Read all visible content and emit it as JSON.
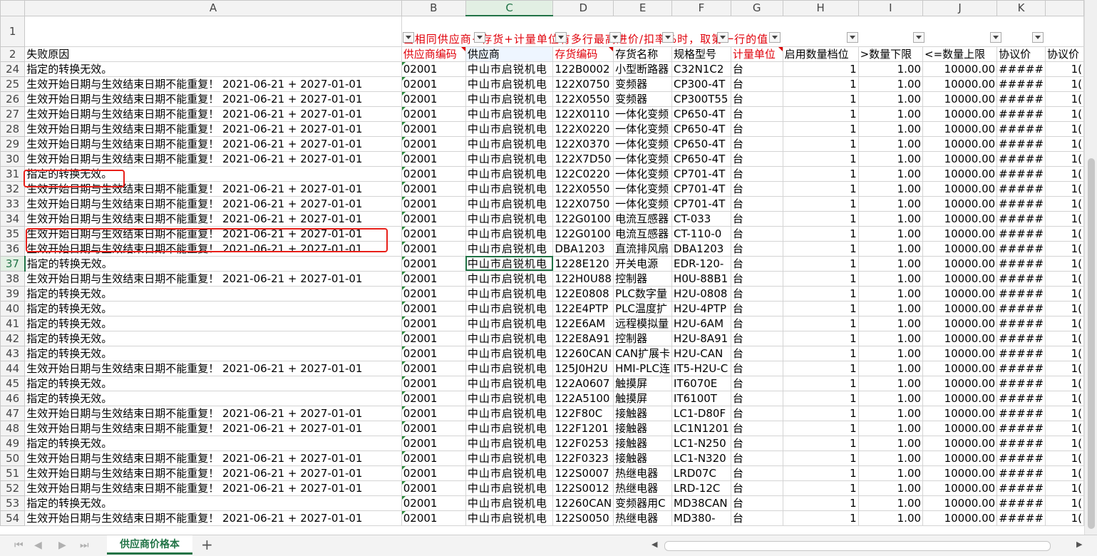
{
  "columns": [
    "",
    "A",
    "B",
    "C",
    "D",
    "E",
    "F",
    "G",
    "H",
    "I",
    "J",
    "K",
    ""
  ],
  "row1": {
    "row_num": "1",
    "b_note": "当相同供应商+存货+计量单位有多行最高进价/扣率%时，取第一行的值"
  },
  "row2": {
    "row_num": "2",
    "cells": [
      "失败原因",
      "供应商编码",
      "供应商",
      "存货编码",
      "存货名称",
      "规格型号",
      "计量单位",
      "启用数量档位",
      ">数量下限",
      "<=数量上限",
      "协议价",
      "协议价"
    ]
  },
  "rows": [
    {
      "n": "24",
      "a": "指定的转换无效。",
      "b": "02001",
      "c": "中山市启锐机电",
      "d": "122B0002",
      "e": "小型断路器",
      "f": "C32N1C2",
      "g": "台",
      "h": "1",
      "i": "1.00",
      "j": "10000.00",
      "k": "#####",
      "l": "1("
    },
    {
      "n": "25",
      "a": "生效开始日期与生效结束日期不能重复！ 2021-06-21 + 2027-01-01",
      "b": "02001",
      "c": "中山市启锐机电",
      "d": "122X0750",
      "e": "变频器",
      "f": "CP300-4T",
      "g": "台",
      "h": "1",
      "i": "1.00",
      "j": "10000.00",
      "k": "#####",
      "l": "1("
    },
    {
      "n": "26",
      "a": "生效开始日期与生效结束日期不能重复！ 2021-06-21 + 2027-01-01",
      "b": "02001",
      "c": "中山市启锐机电",
      "d": "122X0550",
      "e": "变频器",
      "f": "CP300T55",
      "g": "台",
      "h": "1",
      "i": "1.00",
      "j": "10000.00",
      "k": "#####",
      "l": "1("
    },
    {
      "n": "27",
      "a": "生效开始日期与生效结束日期不能重复！ 2021-06-21 + 2027-01-01",
      "b": "02001",
      "c": "中山市启锐机电",
      "d": "122X0110",
      "e": "一体化变频",
      "f": "CP650-4T",
      "g": "台",
      "h": "1",
      "i": "1.00",
      "j": "10000.00",
      "k": "#####",
      "l": "1("
    },
    {
      "n": "28",
      "a": "生效开始日期与生效结束日期不能重复！ 2021-06-21 + 2027-01-01",
      "b": "02001",
      "c": "中山市启锐机电",
      "d": "122X0220",
      "e": "一体化变频",
      "f": "CP650-4T",
      "g": "台",
      "h": "1",
      "i": "1.00",
      "j": "10000.00",
      "k": "#####",
      "l": "1("
    },
    {
      "n": "29",
      "a": "生效开始日期与生效结束日期不能重复！ 2021-06-21 + 2027-01-01",
      "b": "02001",
      "c": "中山市启锐机电",
      "d": "122X0370",
      "e": "一体化变频",
      "f": "CP650-4T",
      "g": "台",
      "h": "1",
      "i": "1.00",
      "j": "10000.00",
      "k": "#####",
      "l": "1("
    },
    {
      "n": "30",
      "a": "生效开始日期与生效结束日期不能重复！ 2021-06-21 + 2027-01-01",
      "b": "02001",
      "c": "中山市启锐机电",
      "d": "122X7D50",
      "e": "一体化变频",
      "f": "CP650-4T",
      "g": "台",
      "h": "1",
      "i": "1.00",
      "j": "10000.00",
      "k": "#####",
      "l": "1("
    },
    {
      "n": "31",
      "a": "指定的转换无效。",
      "b": "02001",
      "c": "中山市启锐机电",
      "d": "122C0220",
      "e": "一体化变频",
      "f": "CP701-4T",
      "g": "台",
      "h": "1",
      "i": "1.00",
      "j": "10000.00",
      "k": "#####",
      "l": "1("
    },
    {
      "n": "32",
      "a": "生效开始日期与生效结束日期不能重复！ 2021-06-21 + 2027-01-01",
      "b": "02001",
      "c": "中山市启锐机电",
      "d": "122X0550",
      "e": "一体化变频",
      "f": "CP701-4T",
      "g": "台",
      "h": "1",
      "i": "1.00",
      "j": "10000.00",
      "k": "#####",
      "l": "1("
    },
    {
      "n": "33",
      "a": "生效开始日期与生效结束日期不能重复！ 2021-06-21 + 2027-01-01",
      "b": "02001",
      "c": "中山市启锐机电",
      "d": "122X0750",
      "e": "一体化变频",
      "f": "CP701-4T",
      "g": "台",
      "h": "1",
      "i": "1.00",
      "j": "10000.00",
      "k": "#####",
      "l": "1("
    },
    {
      "n": "34",
      "a": "生效开始日期与生效结束日期不能重复！ 2021-06-21 + 2027-01-01",
      "b": "02001",
      "c": "中山市启锐机电",
      "d": "122G0100",
      "e": "电流互感器",
      "f": "CT-033",
      "g": "台",
      "h": "1",
      "i": "1.00",
      "j": "10000.00",
      "k": "#####",
      "l": "1("
    },
    {
      "n": "35",
      "a": "生效开始日期与生效结束日期不能重复！ 2021-06-21 + 2027-01-01",
      "b": "02001",
      "c": "中山市启锐机电",
      "d": "122G0100",
      "e": "电流互感器",
      "f": "CT-110-0",
      "g": "台",
      "h": "1",
      "i": "1.00",
      "j": "10000.00",
      "k": "#####",
      "l": "1("
    },
    {
      "n": "36",
      "a": "生效开始日期与生效结束日期不能重复！ 2021-06-21 + 2027-01-01",
      "b": "02001",
      "c": "中山市启锐机电",
      "d": "DBA1203",
      "e": "直流排风扇",
      "f": "DBA1203",
      "g": "台",
      "h": "1",
      "i": "1.00",
      "j": "10000.00",
      "k": "#####",
      "l": "1("
    },
    {
      "n": "37",
      "a": "指定的转换无效。",
      "b": "02001",
      "c": "中山市启锐机电",
      "d": "1228E120",
      "e": "开关电源",
      "f": "EDR-120-",
      "g": "台",
      "h": "1",
      "i": "1.00",
      "j": "10000.00",
      "k": "#####",
      "l": "1("
    },
    {
      "n": "38",
      "a": "生效开始日期与生效结束日期不能重复！ 2021-06-21 + 2027-01-01",
      "b": "02001",
      "c": "中山市启锐机电",
      "d": "122H0U88",
      "e": "控制器",
      "f": "H0U-88B1",
      "g": "台",
      "h": "1",
      "i": "1.00",
      "j": "10000.00",
      "k": "#####",
      "l": "1("
    },
    {
      "n": "39",
      "a": "指定的转换无效。",
      "b": "02001",
      "c": "中山市启锐机电",
      "d": "122E0808",
      "e": "PLC数字量",
      "f": "H2U-0808",
      "g": "台",
      "h": "1",
      "i": "1.00",
      "j": "10000.00",
      "k": "#####",
      "l": "1("
    },
    {
      "n": "40",
      "a": "指定的转换无效。",
      "b": "02001",
      "c": "中山市启锐机电",
      "d": "122E4PTP",
      "e": "PLC温度扩",
      "f": "H2U-4PTP",
      "g": "台",
      "h": "1",
      "i": "1.00",
      "j": "10000.00",
      "k": "#####",
      "l": "1("
    },
    {
      "n": "41",
      "a": "指定的转换无效。",
      "b": "02001",
      "c": "中山市启锐机电",
      "d": "122E6AM",
      "e": "远程模拟量",
      "f": "H2U-6AM",
      "g": "台",
      "h": "1",
      "i": "1.00",
      "j": "10000.00",
      "k": "#####",
      "l": "1("
    },
    {
      "n": "42",
      "a": "指定的转换无效。",
      "b": "02001",
      "c": "中山市启锐机电",
      "d": "122E8A91",
      "e": "控制器",
      "f": "H2U-8A91",
      "g": "台",
      "h": "1",
      "i": "1.00",
      "j": "10000.00",
      "k": "#####",
      "l": "1("
    },
    {
      "n": "43",
      "a": "指定的转换无效。",
      "b": "02001",
      "c": "中山市启锐机电",
      "d": "12260CAN",
      "e": "CAN扩展卡",
      "f": "H2U-CAN",
      "g": "台",
      "h": "1",
      "i": "1.00",
      "j": "10000.00",
      "k": "#####",
      "l": "1("
    },
    {
      "n": "44",
      "a": "生效开始日期与生效结束日期不能重复！ 2021-06-21 + 2027-01-01",
      "b": "02001",
      "c": "中山市启锐机电",
      "d": "125J0H2U",
      "e": "HMI-PLC连",
      "f": "IT5-H2U-C",
      "g": "台",
      "h": "1",
      "i": "1.00",
      "j": "10000.00",
      "k": "#####",
      "l": "1("
    },
    {
      "n": "45",
      "a": "指定的转换无效。",
      "b": "02001",
      "c": "中山市启锐机电",
      "d": "122A0607",
      "e": "触摸屏",
      "f": "IT6070E",
      "g": "台",
      "h": "1",
      "i": "1.00",
      "j": "10000.00",
      "k": "#####",
      "l": "1("
    },
    {
      "n": "46",
      "a": "指定的转换无效。",
      "b": "02001",
      "c": "中山市启锐机电",
      "d": "122A5100",
      "e": "触摸屏",
      "f": "IT6100T",
      "g": "台",
      "h": "1",
      "i": "1.00",
      "j": "10000.00",
      "k": "#####",
      "l": "1("
    },
    {
      "n": "47",
      "a": "生效开始日期与生效结束日期不能重复！ 2021-06-21 + 2027-01-01",
      "b": "02001",
      "c": "中山市启锐机电",
      "d": "122F80C",
      "e": "接触器",
      "f": "LC1-D80F",
      "g": "台",
      "h": "1",
      "i": "1.00",
      "j": "10000.00",
      "k": "#####",
      "l": "1("
    },
    {
      "n": "48",
      "a": "生效开始日期与生效结束日期不能重复！ 2021-06-21 + 2027-01-01",
      "b": "02001",
      "c": "中山市启锐机电",
      "d": "122F1201",
      "e": "接触器",
      "f": "LC1N1201",
      "g": "台",
      "h": "1",
      "i": "1.00",
      "j": "10000.00",
      "k": "#####",
      "l": "1("
    },
    {
      "n": "49",
      "a": "指定的转换无效。",
      "b": "02001",
      "c": "中山市启锐机电",
      "d": "122F0253",
      "e": "接触器",
      "f": "LC1-N250",
      "g": "台",
      "h": "1",
      "i": "1.00",
      "j": "10000.00",
      "k": "#####",
      "l": "1("
    },
    {
      "n": "50",
      "a": "生效开始日期与生效结束日期不能重复！ 2021-06-21 + 2027-01-01",
      "b": "02001",
      "c": "中山市启锐机电",
      "d": "122F0323",
      "e": "接触器",
      "f": "LC1-N320",
      "g": "台",
      "h": "1",
      "i": "1.00",
      "j": "10000.00",
      "k": "#####",
      "l": "1("
    },
    {
      "n": "51",
      "a": "生效开始日期与生效结束日期不能重复！ 2021-06-21 + 2027-01-01",
      "b": "02001",
      "c": "中山市启锐机电",
      "d": "122S0007",
      "e": "热继电器",
      "f": "LRD07C",
      "g": "台",
      "h": "1",
      "i": "1.00",
      "j": "10000.00",
      "k": "#####",
      "l": "1("
    },
    {
      "n": "52",
      "a": "生效开始日期与生效结束日期不能重复！ 2021-06-21 + 2027-01-01",
      "b": "02001",
      "c": "中山市启锐机电",
      "d": "122S0012",
      "e": "热继电器",
      "f": "LRD-12C",
      "g": "台",
      "h": "1",
      "i": "1.00",
      "j": "10000.00",
      "k": "#####",
      "l": "1("
    },
    {
      "n": "53",
      "a": "指定的转换无效。",
      "b": "02001",
      "c": "中山市启锐机电",
      "d": "12260CAN",
      "e": "变频器用C",
      "f": "MD38CAN",
      "g": "台",
      "h": "1",
      "i": "1.00",
      "j": "10000.00",
      "k": "#####",
      "l": "1("
    },
    {
      "n": "54",
      "a": "生效开始日期与生效结束日期不能重复！ 2021-06-21 + 2027-01-01",
      "b": "02001",
      "c": "中山市启锐机电",
      "d": "122S0050",
      "e": "热继电器",
      "f": "MD380-",
      "g": "台",
      "h": "1",
      "i": "1.00",
      "j": "10000.00",
      "k": "#####",
      "l": "1("
    }
  ],
  "selected_cell": {
    "row": "37",
    "col": "C"
  },
  "sheet_tabs": [
    {
      "label": "供应商价格本",
      "active": true
    }
  ],
  "add_sheet": "+",
  "nav_arrows": [
    "⏮",
    "◀",
    "▶",
    "⏭"
  ],
  "accent_color": "#217346",
  "highlight_color": "#e8201a"
}
